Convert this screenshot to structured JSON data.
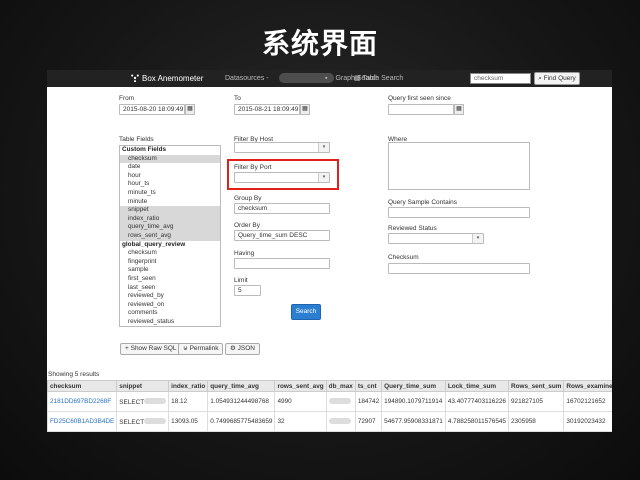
{
  "slide": {
    "title": "系统界面"
  },
  "navbar": {
    "brand": "Box Anemometer",
    "datasources": "Datasources -",
    "graph_search": "Graph Search",
    "table_search": "Table Search",
    "search_placeholder": "checksum",
    "find_query": "Find Query"
  },
  "form": {
    "from_label": "From",
    "from_value": "2015-08-20 18:09:49",
    "to_label": "To",
    "to_value": "2015-08-21 18:09:49",
    "first_seen_label": "Query first seen since",
    "table_fields_label": "Table Fields",
    "filter_host_label": "Filter By Host",
    "filter_port_label": "Filter By Port",
    "group_by_label": "Group By",
    "group_by_value": "checksum",
    "order_by_label": "Order By",
    "order_by_value": "Query_time_sum DESC",
    "having_label": "Having",
    "limit_label": "Limit",
    "limit_value": "5",
    "where_label": "Where",
    "sample_contains_label": "Query Sample Contains",
    "reviewed_status_label": "Reviewed Status",
    "checksum_label": "Checksum",
    "search_button": "Search"
  },
  "fields": [
    {
      "text": "Custom Fields",
      "group": true,
      "selected": false
    },
    {
      "text": "checksum",
      "group": false,
      "selected": true
    },
    {
      "text": "date",
      "group": false,
      "selected": false
    },
    {
      "text": "hour",
      "group": false,
      "selected": false
    },
    {
      "text": "hour_ts",
      "group": false,
      "selected": false
    },
    {
      "text": "minute_ts",
      "group": false,
      "selected": false
    },
    {
      "text": "minute",
      "group": false,
      "selected": false
    },
    {
      "text": "snippet",
      "group": false,
      "selected": true
    },
    {
      "text": "index_ratio",
      "group": false,
      "selected": true
    },
    {
      "text": "query_time_avg",
      "group": false,
      "selected": true
    },
    {
      "text": "rows_sent_avg",
      "group": false,
      "selected": true
    },
    {
      "text": "global_query_review",
      "group": true,
      "selected": false
    },
    {
      "text": "checksum",
      "group": false,
      "selected": false
    },
    {
      "text": "fingerprint",
      "group": false,
      "selected": false
    },
    {
      "text": "sample",
      "group": false,
      "selected": false
    },
    {
      "text": "first_seen",
      "group": false,
      "selected": false
    },
    {
      "text": "last_seen",
      "group": false,
      "selected": false
    },
    {
      "text": "reviewed_by",
      "group": false,
      "selected": false
    },
    {
      "text": "reviewed_on",
      "group": false,
      "selected": false
    },
    {
      "text": "comments",
      "group": false,
      "selected": false
    },
    {
      "text": "reviewed_status",
      "group": false,
      "selected": false
    }
  ],
  "toolbar": {
    "show_raw_sql": "Show Raw SQL",
    "permalink": "Permalink",
    "json": "JSON"
  },
  "results": {
    "showing": "Showing 5 results",
    "headers": [
      "checksum",
      "snippet",
      "index_ratio",
      "query_time_avg",
      "rows_sent_avg",
      "db_max",
      "ts_cnt",
      "Query_time_sum",
      "Lock_time_sum",
      "Rows_sent_sum",
      "Rows_examined_sum"
    ],
    "rows": [
      [
        "2181DD697BD2268F",
        "SELECT",
        "18.12",
        "1.054931244498768",
        "4990",
        "",
        "184742",
        "194890.1079711914",
        "43.40777403116226",
        "921827105",
        "16702121652"
      ],
      [
        "FD25C60B1AD3B4DE",
        "SELECT",
        "13093.05",
        "0.7499685775483659",
        "32",
        "",
        "72907",
        "54677.95908331871",
        "4.788258011576545",
        "2305958",
        "30192023432"
      ]
    ]
  },
  "colors": {
    "highlight": "#e0201b",
    "primary_button": "#2c7fd0",
    "navbar": "#222222"
  }
}
